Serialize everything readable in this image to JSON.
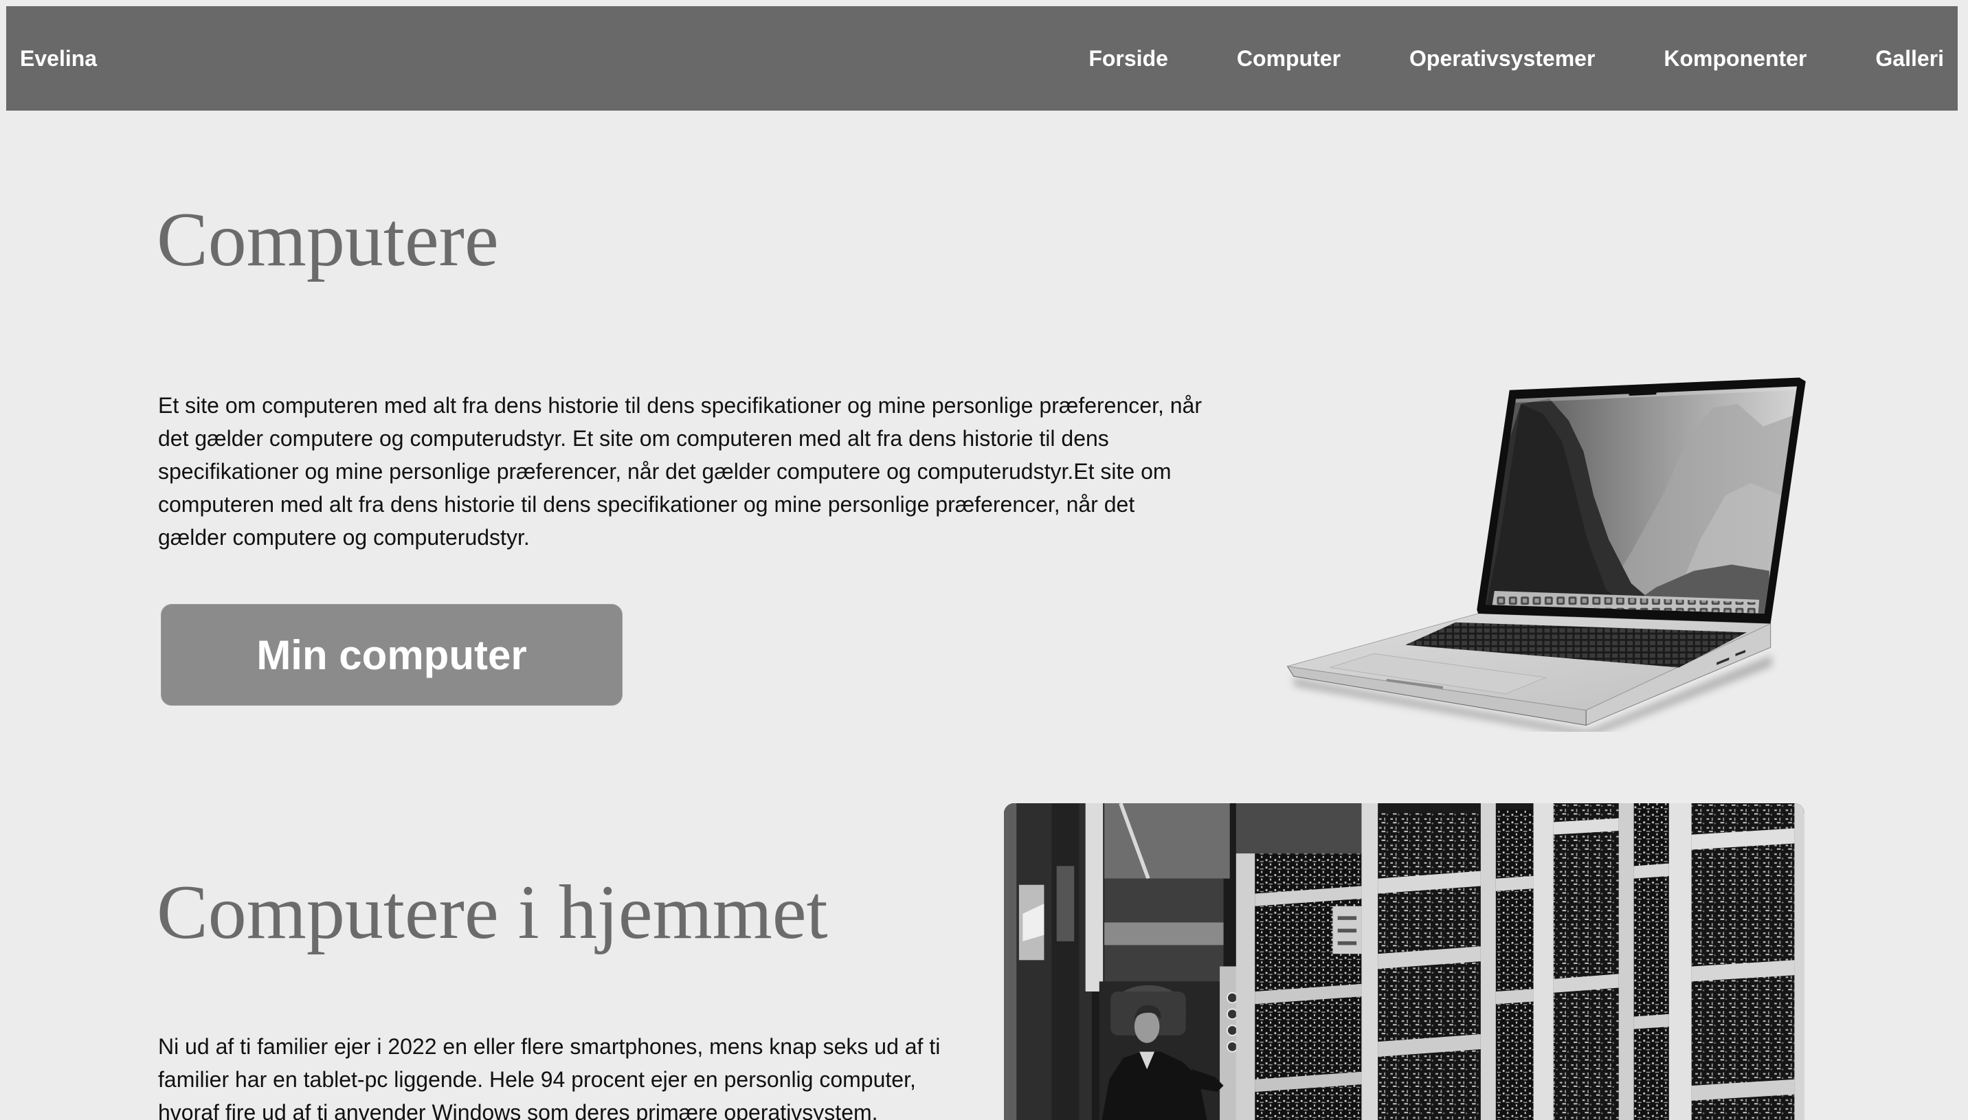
{
  "nav": {
    "brand": "Evelina",
    "items": [
      {
        "label": "Forside"
      },
      {
        "label": "Computer"
      },
      {
        "label": "Operativsystemer"
      },
      {
        "label": "Komponenter"
      },
      {
        "label": "Galleri"
      }
    ]
  },
  "hero": {
    "title": "Computere",
    "text": "Et site om computeren med alt fra dens historie til dens specifikationer og mine personlige præferencer, når det gælder computere og computerudstyr. Et site om computeren med alt fra dens historie til dens specifikationer og mine personlige præferencer, når det gælder computere og computerudstyr.Et site om computeren med alt fra dens historie til dens specifikationer og mine personlige præferencer, når det gælder computere og computerudstyr.",
    "button_label": "Min computer",
    "image": "laptop-image"
  },
  "home": {
    "title": "Computere i hjemmet",
    "text": "Ni ud af ti familier ejer i 2022 en eller flere smartphones, mens knap seks ud af ti familier har en tablet-pc liggende. Hele 94 procent ejer en personlig computer, hvoraf fire ud af ti anvender Windows som deres primære operativsystem.",
    "image": "vintage-computer-room-photo"
  },
  "colors": {
    "page_background": "#ececec",
    "nav_background": "#696969",
    "nav_text": "#ffffff",
    "heading": "#6b6b6b",
    "body_text": "#111111",
    "button_background": "#8b8b8b",
    "button_text": "#ffffff"
  }
}
